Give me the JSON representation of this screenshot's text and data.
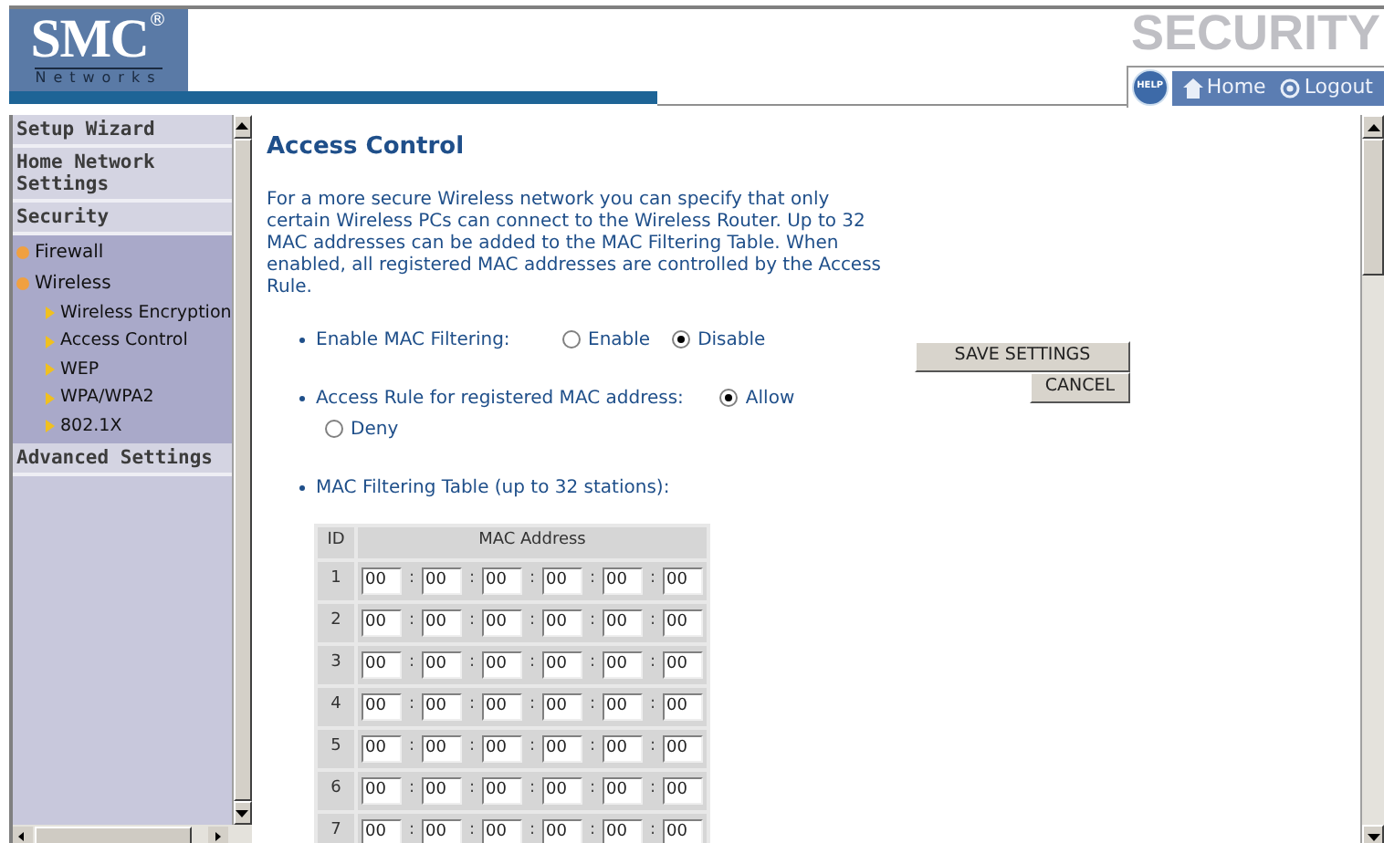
{
  "header": {
    "logo": "SMC",
    "logo_mark": "®",
    "logo_sub": "Networks",
    "section_title": "SECURITY",
    "nav": [
      {
        "kind": "help",
        "label": "HELP"
      },
      {
        "kind": "home",
        "label": "Home"
      },
      {
        "kind": "logout",
        "label": "Logout"
      }
    ]
  },
  "sidebar": [
    {
      "label": "Setup Wizard",
      "kind": "section"
    },
    {
      "label": "Home Network Settings",
      "kind": "section"
    },
    {
      "label": "Security",
      "kind": "section",
      "children": [
        {
          "label": "Firewall"
        },
        {
          "label": "Wireless",
          "children": [
            {
              "label": "Wireless Encryption"
            },
            {
              "label": "Access Control"
            },
            {
              "label": "WEP"
            },
            {
              "label": "WPA/WPA2"
            },
            {
              "label": "802.1X"
            }
          ]
        }
      ]
    },
    {
      "label": "Advanced Settings",
      "kind": "section"
    }
  ],
  "main": {
    "title": "Access Control",
    "description": "For a more secure Wireless network you can specify that only certain Wireless PCs can connect to the Wireless Router. Up to 32 MAC addresses can be added to the MAC Filtering Table. When enabled, all registered MAC addresses are controlled by the Access Rule.",
    "settings": [
      {
        "label": "Enable MAC Filtering:",
        "options": [
          {
            "label": "Enable",
            "selected": false
          },
          {
            "label": "Disable",
            "selected": true
          }
        ]
      },
      {
        "label": "Access Rule for registered MAC address:",
        "options": [
          {
            "label": "Allow",
            "selected": true
          },
          {
            "label": "Deny",
            "selected": false
          }
        ]
      },
      {
        "label": "MAC Filtering Table (up to 32 stations):"
      }
    ],
    "buttons": [
      "SAVE SETTINGS",
      "CANCEL"
    ],
    "table": {
      "columns": [
        "ID",
        "MAC Address"
      ],
      "rows": [
        {
          "id": "1",
          "octets": [
            "00",
            "00",
            "00",
            "00",
            "00",
            "00"
          ]
        },
        {
          "id": "2",
          "octets": [
            "00",
            "00",
            "00",
            "00",
            "00",
            "00"
          ]
        },
        {
          "id": "3",
          "octets": [
            "00",
            "00",
            "00",
            "00",
            "00",
            "00"
          ]
        },
        {
          "id": "4",
          "octets": [
            "00",
            "00",
            "00",
            "00",
            "00",
            "00"
          ]
        },
        {
          "id": "5",
          "octets": [
            "00",
            "00",
            "00",
            "00",
            "00",
            "00"
          ]
        },
        {
          "id": "6",
          "octets": [
            "00",
            "00",
            "00",
            "00",
            "00",
            "00"
          ]
        },
        {
          "id": "7",
          "octets": [
            "00",
            "00",
            "00",
            "00",
            "00",
            "00"
          ]
        }
      ],
      "separator": ":"
    }
  }
}
